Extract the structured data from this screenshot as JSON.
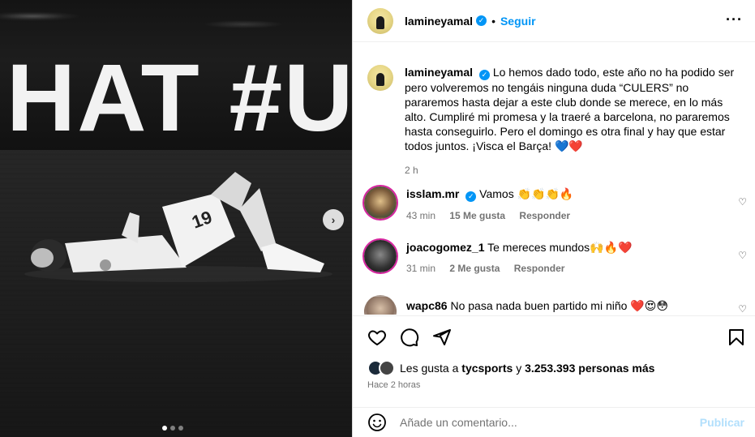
{
  "post": {
    "username": "lamineyamal",
    "follow_label": "Seguir",
    "separator": "•",
    "more_label": "···",
    "board_text": "HAT #U",
    "caption_text": "Lo hemos dado todo, este año no ha podido ser pero volveremos no tengáis ninguna duda “CULERS” no pararemos hasta dejar a este club donde se merece, en lo más alto. Cumpliré mi promesa y la traeré a barcelona, no pararemos hasta conseguirlo. Pero el domingo es otra final y hay que estar todos juntos. ¡Visca el Barça! 💙❤️",
    "caption_time": "2 h",
    "image_count": 3,
    "active_image": 1
  },
  "comments": [
    {
      "username": "isslam.mr",
      "verified": true,
      "text": "Vamos 👏👏👏🔥",
      "time": "43 min",
      "likes": "15 Me gusta",
      "reply": "Responder"
    },
    {
      "username": "joacogomez_1",
      "verified": false,
      "text": "Te mereces mundos🙌🔥❤️",
      "time": "31 min",
      "likes": "2 Me gusta",
      "reply": "Responder"
    },
    {
      "username": "wapc86",
      "verified": false,
      "text": "No pasa nada buen partido mi niño ❤️😍😳"
    }
  ],
  "likes_bar": {
    "prefix": "Les gusta a ",
    "user": "tycsports",
    "middle": " y ",
    "count": "3.253.393 personas más",
    "ago": "Hace 2 horas"
  },
  "comment_box": {
    "placeholder": "Añade un comentario...",
    "publish_label": "Publicar"
  },
  "icons": {
    "next": "chevron-right-icon",
    "like": "heart-icon",
    "comment": "comment-icon",
    "share": "share-icon",
    "save": "bookmark-icon",
    "emoji": "emoji-icon"
  },
  "colors": {
    "accent": "#0095f6",
    "publish_disabled": "#b2dffc",
    "muted": "#737373"
  }
}
